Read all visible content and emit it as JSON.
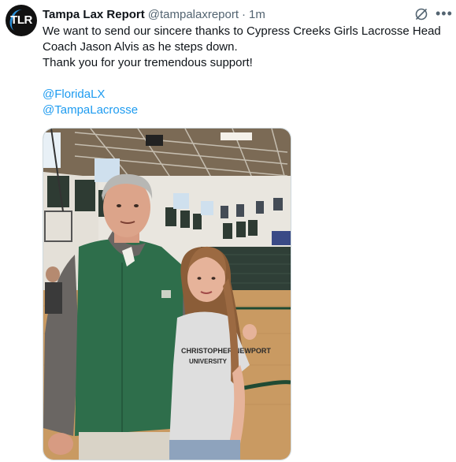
{
  "author": {
    "avatar_text": "TLR",
    "name": "Tampa Lax Report",
    "handle": "@tampalaxreport",
    "separator": "·",
    "time": "1m"
  },
  "tweet": {
    "line1": "We want to send our sincere thanks to Cypress Creeks Girls Lacrosse Head",
    "line2": "Coach Jason Alvis as he steps down.",
    "line3": "Thank you for your tremendous support!",
    "mention1": "@FloridaLX",
    "mention2": "@TampaLacrosse"
  },
  "photo": {
    "shirt_text_1": "CHRISTOPHER NEWPORT",
    "shirt_text_2": "UNIVERSITY"
  },
  "icons": {
    "grok": "grok-icon",
    "more": "more-icon"
  },
  "colors": {
    "link": "#1d9bf0",
    "secondary_text": "#536471"
  }
}
